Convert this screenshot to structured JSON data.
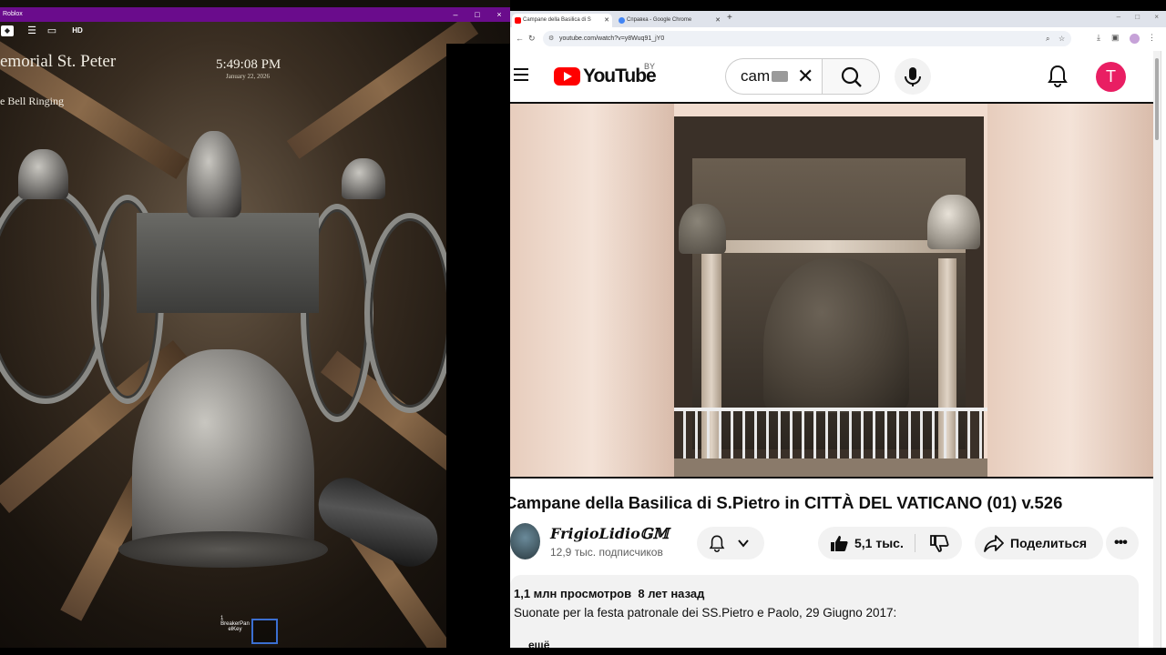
{
  "roblox": {
    "window_title": "Roblox",
    "window_controls": {
      "minimize": "–",
      "maximize": "□",
      "close": "×"
    },
    "toolbar": {
      "hd_label": "HD"
    },
    "hud": {
      "place_title": "emorial St. Peter",
      "mode_label": "e Bell Ringing",
      "time": "5:49:08 PM",
      "date": "January 22, 2026"
    },
    "hotbar": {
      "slot_number": "1",
      "slot_label": "BreakerPan elKey"
    }
  },
  "chrome": {
    "tabs": [
      {
        "label": "Campane della Basilica di S",
        "active": true,
        "favicon_color": "#ff0000"
      },
      {
        "label": "Справка - Google Chrome",
        "active": false,
        "favicon_color": "#4285f4"
      }
    ],
    "new_tab": "+",
    "url": "youtube.com/watch?v=y8Wuq91_jY0",
    "window_controls": {
      "minimize": "–",
      "maximize": "□",
      "close": "×"
    }
  },
  "youtube": {
    "logo_text": "YouTube",
    "region": "BY",
    "search_value": "cam",
    "avatar_letter": "T",
    "video": {
      "title": "Campane della Basilica di S.Pietro in CITTÀ DEL VATICANO (01) v.526",
      "channel_name": "FrigioLidio𝔾𝕄",
      "subscribers": "12,9 тыс. подписчиков",
      "likes": "5,1 тыс.",
      "share_label": "Поделиться",
      "views": "1,1 млн просмотров",
      "age": "8 лет назад",
      "description": "Suonate per la festa patronale dei SS.Pietro e Paolo, 29 Giugno 2017:",
      "description_more": "ещё"
    },
    "colors": {
      "brand_red": "#ff0000",
      "avatar_pink": "#e91e63"
    }
  }
}
